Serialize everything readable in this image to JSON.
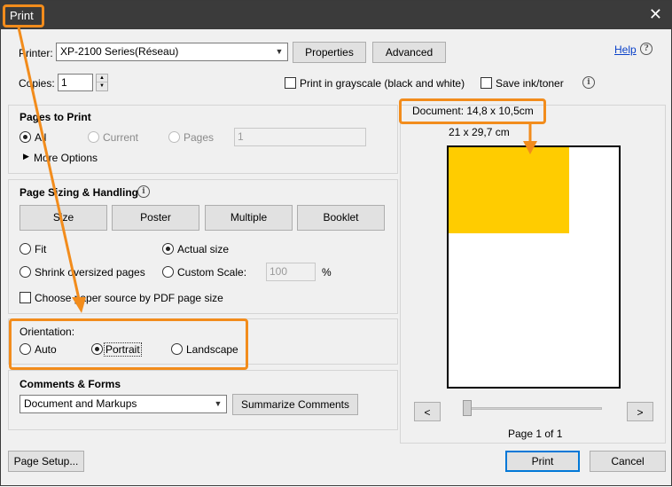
{
  "window": {
    "title": "Print",
    "close_glyph": "✕"
  },
  "help": {
    "label": "Help",
    "icon": "question-icon"
  },
  "printer": {
    "label": "Printer:",
    "selected": "XP-2100 Series(Réseau)",
    "properties_button": "Properties",
    "advanced_button": "Advanced"
  },
  "copies": {
    "label": "Copies:",
    "value": "1"
  },
  "options": {
    "grayscale_label": "Print in grayscale (black and white)",
    "save_ink_label": "Save ink/toner"
  },
  "pages_to_print": {
    "title": "Pages to Print",
    "all": "All",
    "current": "Current",
    "pages": "Pages",
    "pages_value": "1",
    "more_options": "More Options"
  },
  "sizing": {
    "title": "Page Sizing & Handling",
    "buttons": [
      "Size",
      "Poster",
      "Multiple",
      "Booklet"
    ],
    "fit": "Fit",
    "actual_size": "Actual size",
    "shrink": "Shrink oversized pages",
    "custom_scale": "Custom Scale:",
    "custom_scale_value": "100",
    "percent": "%",
    "choose_source": "Choose paper source by PDF page size"
  },
  "orientation": {
    "title": "Orientation:",
    "auto": "Auto",
    "portrait": "Portrait",
    "landscape": "Landscape"
  },
  "comments": {
    "title": "Comments & Forms",
    "selected": "Document and Markups",
    "summarize_button": "Summarize Comments"
  },
  "preview": {
    "document_size": "Document: 14,8 x 10,5cm",
    "paper_size": "21 x 29,7 cm",
    "page_indicator": "Page 1 of 1",
    "prev": "<",
    "next": ">",
    "doc_color": "#ffcc00"
  },
  "footer": {
    "page_setup": "Page Setup...",
    "print": "Print",
    "cancel": "Cancel"
  },
  "accent": {
    "annotation": "#f28c1c",
    "default_button": "#0078d7"
  }
}
